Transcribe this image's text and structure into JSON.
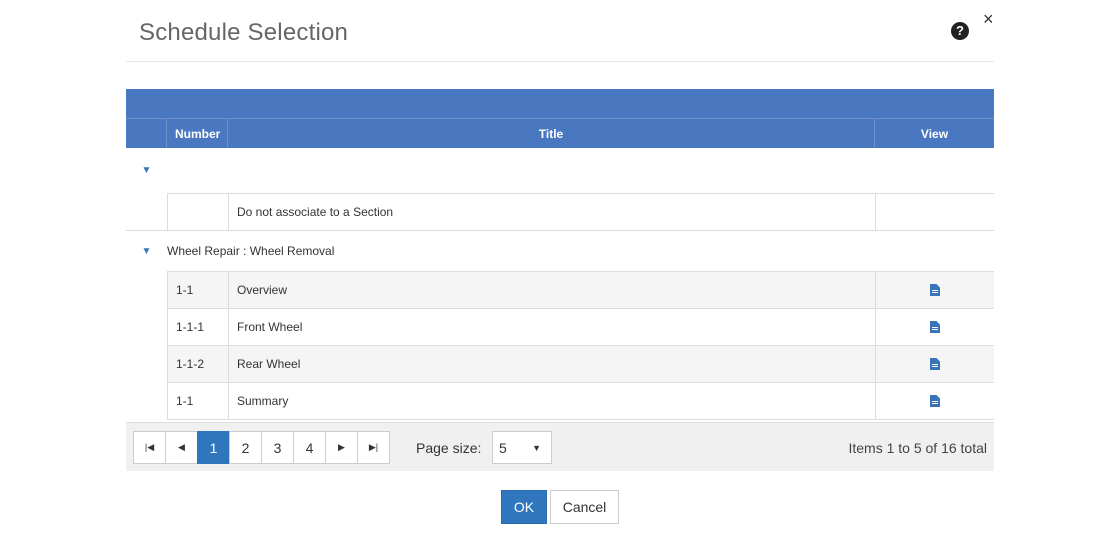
{
  "dialog": {
    "title": "Schedule Selection",
    "help_icon": "question-circle-icon",
    "close_icon": "close-icon",
    "close_glyph": "×",
    "help_glyph": "?"
  },
  "grid": {
    "columns": {
      "number": "Number",
      "title": "Title",
      "view": "View"
    },
    "groups": [
      {
        "label": "",
        "toggle": "▼",
        "rows": [
          {
            "number": "",
            "title": "Do not associate to a Section",
            "has_view": false
          }
        ]
      },
      {
        "label": "Wheel Repair : Wheel Removal",
        "toggle": "▼",
        "rows": [
          {
            "number": "1-1",
            "title": "Overview",
            "has_view": true
          },
          {
            "number": "1-1-1",
            "title": "Front Wheel",
            "has_view": true
          },
          {
            "number": "1-1-2",
            "title": "Rear Wheel",
            "has_view": true
          },
          {
            "number": "1-1",
            "title": "Summary",
            "has_view": true
          }
        ]
      }
    ]
  },
  "pager": {
    "first": "⏮",
    "prev": "◀",
    "next": "▶",
    "last": "⏭",
    "first_glyph": "|◀",
    "last_glyph": "▶|",
    "pages": [
      "1",
      "2",
      "3",
      "4"
    ],
    "current": "1",
    "page_size_label": "Page size:",
    "page_size_value": "5",
    "caret": "▼",
    "items_info": "Items 1 to 5 of 16 total"
  },
  "footer": {
    "ok_label": "OK",
    "cancel_label": "Cancel"
  },
  "colors": {
    "header_blue": "#4a78c0",
    "primary": "#2f76bd",
    "icon_blue": "#3a74b8"
  }
}
